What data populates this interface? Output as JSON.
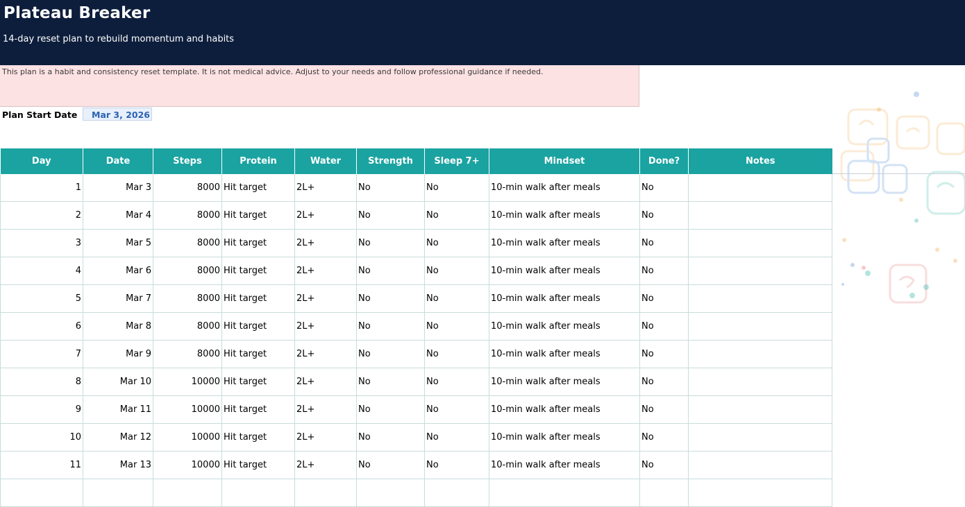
{
  "header": {
    "title": "Plateau Breaker",
    "subtitle": "14-day reset plan to rebuild momentum and habits"
  },
  "disclaimer": {
    "text": "This plan is a habit and consistency reset template. It is not medical advice. Adjust to your needs and follow professional guidance if needed."
  },
  "start_date": {
    "label": "Plan Start Date",
    "value": "Mar 3, 2026"
  },
  "table": {
    "columns": [
      "Day",
      "Date",
      "Steps",
      "Protein",
      "Water",
      "Strength",
      "Sleep 7+",
      "Mindset",
      "Done?",
      "Notes"
    ],
    "rows": [
      {
        "day": "1",
        "date": "Mar 3",
        "steps": "8000",
        "protein": "Hit target",
        "water": "2L+",
        "strength": "No",
        "sleep": "No",
        "mindset": "10-min walk after meals",
        "done": "No",
        "notes": ""
      },
      {
        "day": "2",
        "date": "Mar 4",
        "steps": "8000",
        "protein": "Hit target",
        "water": "2L+",
        "strength": "No",
        "sleep": "No",
        "mindset": "10-min walk after meals",
        "done": "No",
        "notes": ""
      },
      {
        "day": "3",
        "date": "Mar 5",
        "steps": "8000",
        "protein": "Hit target",
        "water": "2L+",
        "strength": "No",
        "sleep": "No",
        "mindset": "10-min walk after meals",
        "done": "No",
        "notes": ""
      },
      {
        "day": "4",
        "date": "Mar 6",
        "steps": "8000",
        "protein": "Hit target",
        "water": "2L+",
        "strength": "No",
        "sleep": "No",
        "mindset": "10-min walk after meals",
        "done": "No",
        "notes": ""
      },
      {
        "day": "5",
        "date": "Mar 7",
        "steps": "8000",
        "protein": "Hit target",
        "water": "2L+",
        "strength": "No",
        "sleep": "No",
        "mindset": "10-min walk after meals",
        "done": "No",
        "notes": ""
      },
      {
        "day": "6",
        "date": "Mar 8",
        "steps": "8000",
        "protein": "Hit target",
        "water": "2L+",
        "strength": "No",
        "sleep": "No",
        "mindset": "10-min walk after meals",
        "done": "No",
        "notes": ""
      },
      {
        "day": "7",
        "date": "Mar 9",
        "steps": "8000",
        "protein": "Hit target",
        "water": "2L+",
        "strength": "No",
        "sleep": "No",
        "mindset": "10-min walk after meals",
        "done": "No",
        "notes": ""
      },
      {
        "day": "8",
        "date": "Mar 10",
        "steps": "10000",
        "protein": "Hit target",
        "water": "2L+",
        "strength": "No",
        "sleep": "No",
        "mindset": "10-min walk after meals",
        "done": "No",
        "notes": ""
      },
      {
        "day": "9",
        "date": "Mar 11",
        "steps": "10000",
        "protein": "Hit target",
        "water": "2L+",
        "strength": "No",
        "sleep": "No",
        "mindset": "10-min walk after meals",
        "done": "No",
        "notes": ""
      },
      {
        "day": "10",
        "date": "Mar 12",
        "steps": "10000",
        "protein": "Hit target",
        "water": "2L+",
        "strength": "No",
        "sleep": "No",
        "mindset": "10-min walk after meals",
        "done": "No",
        "notes": ""
      },
      {
        "day": "11",
        "date": "Mar 13",
        "steps": "10000",
        "protein": "Hit target",
        "water": "2L+",
        "strength": "No",
        "sleep": "No",
        "mindset": "10-min walk after meals",
        "done": "No",
        "notes": ""
      },
      {
        "day": "",
        "date": "",
        "steps": "",
        "protein": "",
        "water": "",
        "strength": "",
        "sleep": "",
        "mindset": "",
        "done": "",
        "notes": ""
      }
    ]
  },
  "colors": {
    "header_bg": "#0d1e3c",
    "disclaimer_bg": "#fde2e4",
    "table_header_bg": "#1aa3a1",
    "start_date_text": "#2c62b0"
  },
  "decoration": {
    "icon": "question-bubbles-watermark"
  }
}
